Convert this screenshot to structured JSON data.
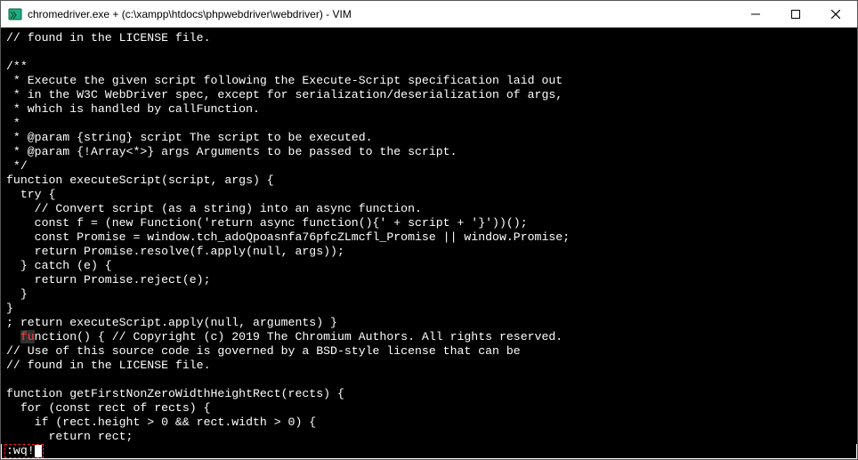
{
  "window": {
    "title": "chromedriver.exe + (c:\\xampp\\htdocs\\phpwebdriver\\webdriver) - VIM"
  },
  "code": {
    "lines": [
      "// found in the LICENSE file.",
      "",
      "/**",
      " * Execute the given script following the Execute-Script specification laid out",
      " * in the W3C WebDriver spec, except for serialization/deserialization of args,",
      " * which is handled by callFunction.",
      " *",
      " * @param {string} script The script to be executed.",
      " * @param {!Array<*>} args Arguments to be passed to the script.",
      " */",
      "function executeScript(script, args) {",
      "  try {",
      "    // Convert script (as a string) into an async function.",
      "    const f = (new Function('return async function(){' + script + '}'))();",
      "    const Promise = window.tch_adoQpoasnfa76pfcZLmcfl_Promise || window.Promise;",
      "    return Promise.resolve(f.apply(null, args));",
      "  } catch (e) {",
      "    return Promise.reject(e);",
      "  }",
      "}",
      "; return executeScript.apply(null, arguments) }",
      "",
      "// Use of this source code is governed by a BSD-style license that can be",
      "// found in the LICENSE file.",
      "",
      "function getFirstNonZeroWidthHeightRect(rects) {",
      "  for (const rect of rects) {",
      "    if (rect.height > 0 && rect.width > 0) {",
      "      return rect;"
    ],
    "red_fn_prefix": "  ",
    "red_fn_text": "fu",
    "red_fn_suffix": "nction() { // Copyright (c) 2019 The Chromium Authors. All rights reserved."
  },
  "cmdline": {
    "text": ":wq!"
  }
}
